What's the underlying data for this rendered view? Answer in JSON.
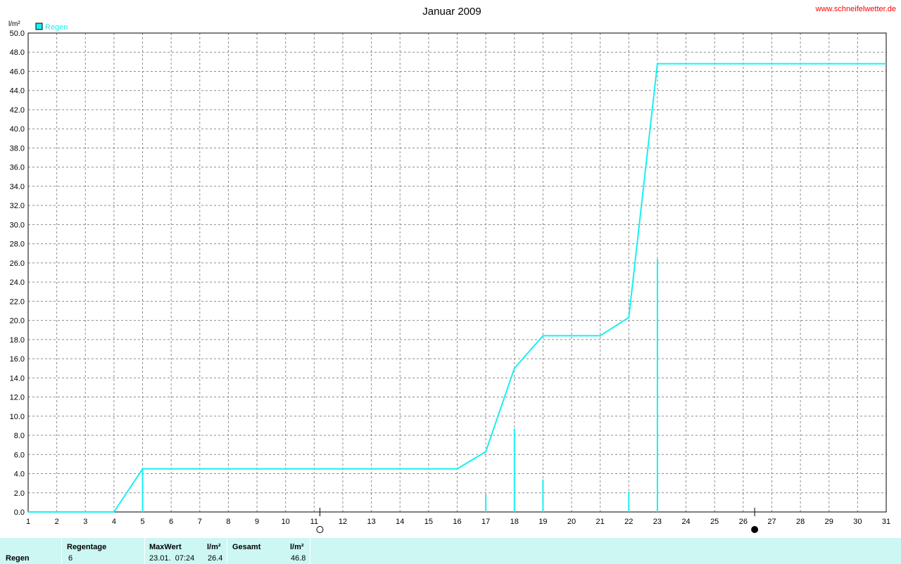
{
  "header": {
    "title": "Januar 2009",
    "site": "www.schneifelwetter.de",
    "unit": "l/m²",
    "legend": "Regen"
  },
  "colors": {
    "series": "#19f0f0",
    "site": "#ff0000",
    "stats_bg": "#ccf7f3"
  },
  "chart_data": {
    "type": "line",
    "title": "Januar 2009",
    "ylabel": "l/m²",
    "xlim": [
      1,
      31
    ],
    "ylim": [
      0,
      50
    ],
    "grid": true,
    "legend_position": "top-left",
    "x_ticks": [
      1,
      2,
      3,
      4,
      5,
      6,
      7,
      8,
      9,
      10,
      11,
      12,
      13,
      14,
      15,
      16,
      17,
      18,
      19,
      20,
      21,
      22,
      23,
      24,
      25,
      26,
      27,
      28,
      29,
      30,
      31
    ],
    "y_ticks": [
      "0.0",
      "2.0",
      "4.0",
      "6.0",
      "8.0",
      "10.0",
      "12.0",
      "14.0",
      "16.0",
      "18.0",
      "20.0",
      "22.0",
      "24.0",
      "26.0",
      "28.0",
      "30.0",
      "32.0",
      "34.0",
      "36.0",
      "38.0",
      "40.0",
      "42.0",
      "44.0",
      "46.0",
      "48.0",
      "50.0"
    ],
    "series": [
      {
        "name": "Regen",
        "kind": "cumulative-line",
        "x": [
          1,
          4,
          5,
          16,
          17,
          18,
          19,
          21,
          22,
          23,
          31
        ],
        "y": [
          0,
          0,
          4.5,
          4.5,
          6.3,
          15.0,
          18.4,
          18.4,
          20.3,
          46.8,
          46.8
        ]
      },
      {
        "kind": "daily-bars",
        "x": [
          5,
          17,
          18,
          19,
          22,
          23
        ],
        "y": [
          4.5,
          1.8,
          8.7,
          3.4,
          2.1,
          26.4
        ]
      }
    ],
    "moon_phases": [
      {
        "phase": "full-moon",
        "x": 11.2
      },
      {
        "phase": "new-moon",
        "x": 26.4
      }
    ]
  },
  "stats": {
    "row_label": "Regen",
    "regentage_label": "Regentage",
    "regentage_value": "6",
    "maxwert_label": "MaxWert",
    "maxwert_unit": "l/m²",
    "maxwert_date": "23.01.  07:24",
    "maxwert_value": "26.4",
    "gesamt_label": "Gesamt",
    "gesamt_unit": "l/m²",
    "gesamt_value": "46.8"
  }
}
